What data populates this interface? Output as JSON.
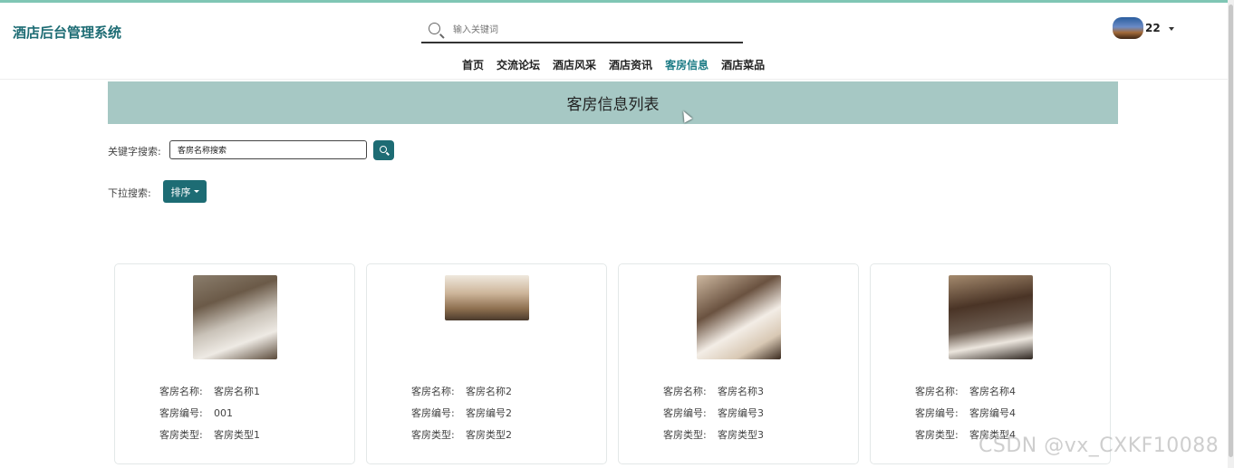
{
  "header": {
    "brand": "酒店后台管理系统",
    "search": {
      "placeholder": "输入关键词",
      "value": ""
    },
    "user": {
      "name": "22"
    }
  },
  "nav": {
    "items": [
      {
        "label": "首页",
        "active": false
      },
      {
        "label": "交流论坛",
        "active": false
      },
      {
        "label": "酒店风采",
        "active": false
      },
      {
        "label": "酒店资讯",
        "active": false
      },
      {
        "label": "客房信息",
        "active": true
      },
      {
        "label": "酒店菜品",
        "active": false
      }
    ]
  },
  "page": {
    "title": "客房信息列表"
  },
  "filters": {
    "keyword_label": "关键字搜索:",
    "keyword_value": "客房名称搜索",
    "dropdown_label": "下拉搜索:",
    "sort_label": "排序"
  },
  "rooms": {
    "field_labels": {
      "name": "客房名称:",
      "number": "客房编号:",
      "type": "客房类型:"
    },
    "items": [
      {
        "name": "客房名称1",
        "number": "001",
        "type": "客房类型1"
      },
      {
        "name": "客房名称2",
        "number": "客房编号2",
        "type": "客房类型2"
      },
      {
        "name": "客房名称3",
        "number": "客房编号3",
        "type": "客房类型3"
      },
      {
        "name": "客房名称4",
        "number": "客房编号4",
        "type": "客房类型4"
      }
    ]
  },
  "watermark": "CSDN @vx_CXKF10088",
  "colors": {
    "accent": "#1d6c74",
    "banner": "#a6c8c4",
    "topline": "#7fc6b4",
    "active_nav": "#1d7c86"
  }
}
